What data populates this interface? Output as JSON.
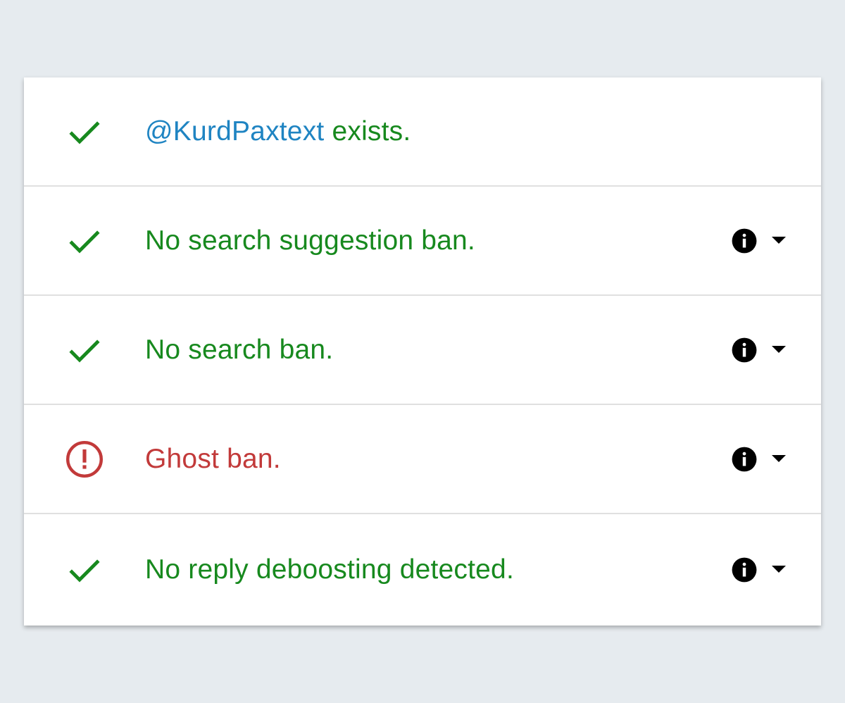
{
  "checks": [
    {
      "status": "ok",
      "icon": "checkmark-icon",
      "handle": "@KurdPaxtext",
      "text": " exists.",
      "has_details": false
    },
    {
      "status": "ok",
      "icon": "checkmark-icon",
      "text": "No search suggestion ban.",
      "has_details": true
    },
    {
      "status": "ok",
      "icon": "checkmark-icon",
      "text": "No search ban.",
      "has_details": true
    },
    {
      "status": "ban",
      "icon": "alert-circle-icon",
      "text": "Ghost ban.",
      "has_details": true
    },
    {
      "status": "ok",
      "icon": "checkmark-icon",
      "text": "No reply deboosting detected.",
      "has_details": true
    }
  ],
  "colors": {
    "ok": "#17891e",
    "ban": "#c23a3a",
    "handle": "#1f84c2",
    "background": "#e6ebef"
  }
}
